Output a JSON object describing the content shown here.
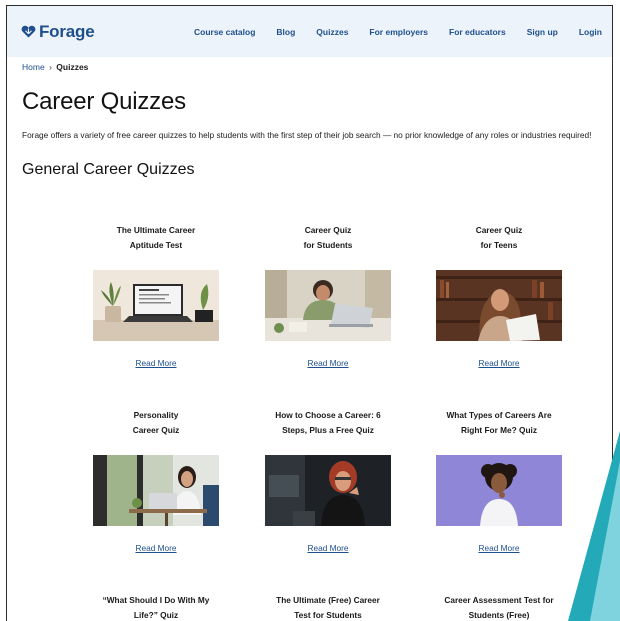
{
  "brand": {
    "name": "Forage",
    "logo_icon": "forage-heart-logo",
    "color": "#1f4f8c"
  },
  "nav": [
    "Course catalog",
    "Blog",
    "Quizzes",
    "For employers",
    "For educators",
    "Sign up",
    "Login"
  ],
  "breadcrumb": {
    "home": "Home",
    "separator": "›",
    "current": "Quizzes"
  },
  "page": {
    "title": "Career Quizzes",
    "intro": "Forage offers a variety of free career quizzes to help students with the first step of their job search — no prior knowledge of any roles or industries required!",
    "section_title": "General Career Quizzes"
  },
  "cards": [
    {
      "title_line1": "The Ultimate Career",
      "title_line2": "Aptitude Test",
      "link": "Read More",
      "image": "laptop-with-plants"
    },
    {
      "title_line1": "Career Quiz",
      "title_line2": "for Students",
      "link": "Read More",
      "image": "student-on-laptop"
    },
    {
      "title_line1": "Career Quiz",
      "title_line2": "for Teens",
      "link": "Read More",
      "image": "teen-reading-in-library"
    },
    {
      "title_line1": "Personality",
      "title_line2": "Career Quiz",
      "link": "Read More",
      "image": "woman-at-cafe-laptop"
    },
    {
      "title_line1": "How to Choose a Career: 6",
      "title_line2": "Steps, Plus a Free Quiz",
      "link": "Read More",
      "image": "woman-thinking-at-desk"
    },
    {
      "title_line1": "What Types of Careers Are",
      "title_line2": "Right For Me? Quiz",
      "link": "Read More",
      "image": "person-thinking-purple"
    },
    {
      "title_line1": "“What Should I Do With My",
      "title_line2": "Life?” Quiz",
      "link": "",
      "image": ""
    },
    {
      "title_line1": "The Ultimate (Free) Career",
      "title_line2": "Test for Students",
      "link": "",
      "image": ""
    },
    {
      "title_line1": "Career Assessment Test for",
      "title_line2": "Students (Free)",
      "link": "",
      "image": ""
    }
  ]
}
